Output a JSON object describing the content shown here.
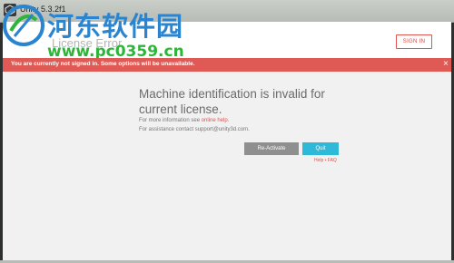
{
  "window": {
    "title": "Unity 5.3.2f1"
  },
  "header": {
    "title": "License Error",
    "sign_in_label": "SIGN IN"
  },
  "watermark": {
    "text": "河东软件园",
    "url": "www.pc0359.cn"
  },
  "notice": {
    "text": "You are currently not signed in. Some options will be unavailable.",
    "close_glyph": "×"
  },
  "content": {
    "error_title": "Machine identification is invalid for current license.",
    "info_prefix": "For more information see ",
    "info_link": "online help",
    "info_suffix": ".",
    "assistance": "For assistance contact support@unity3d.com.",
    "reactivate_label": "Re-Activate",
    "quit_label": "Quit",
    "help_faq": "Help • FAQ"
  },
  "colors": {
    "accent": "#e05a55",
    "quit": "#2fb9d8",
    "reactivate": "#8f8f8f"
  }
}
